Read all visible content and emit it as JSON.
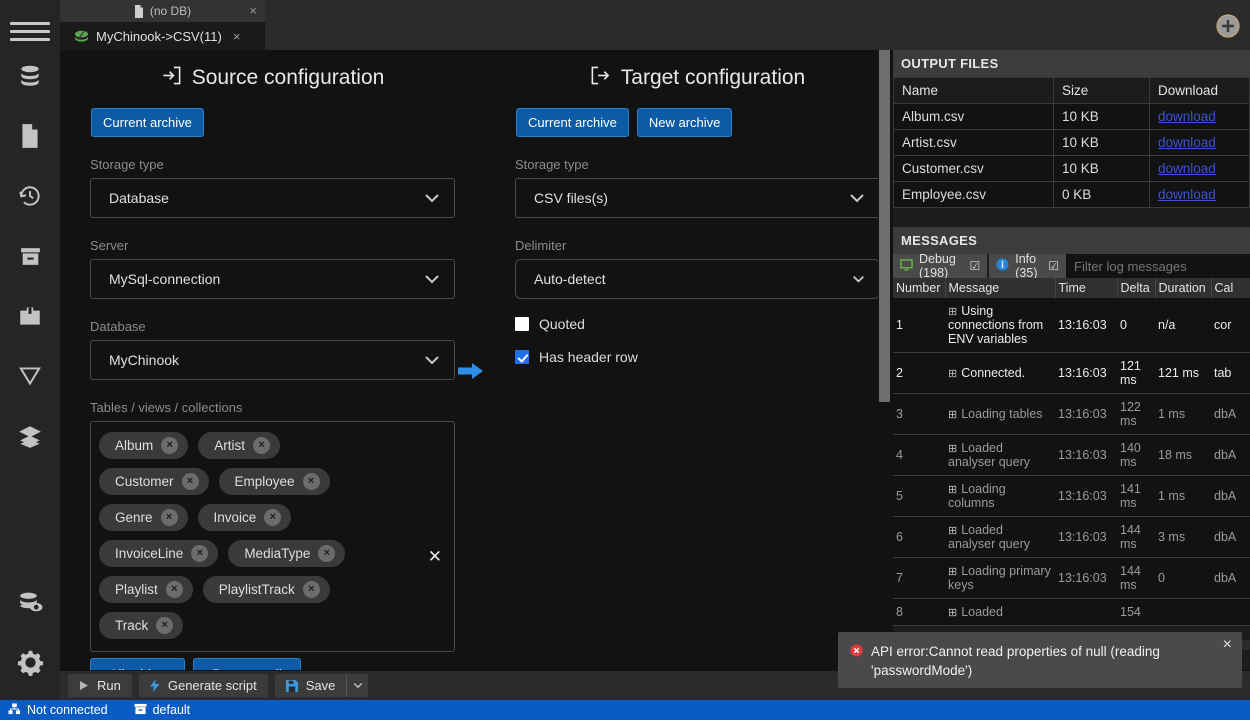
{
  "window": {
    "add_tab_icon": "plus-circle-icon"
  },
  "rail": {
    "menu_icon": "hamburger-menu-icon",
    "items": [
      {
        "icon": "database-icon"
      },
      {
        "icon": "file-icon"
      },
      {
        "icon": "history-clock-icon"
      },
      {
        "icon": "archive-box-icon"
      },
      {
        "icon": "toolbox-icon"
      },
      {
        "icon": "filter-funnel-icon"
      },
      {
        "icon": "layers-icon"
      },
      {
        "icon": "database-eye-icon"
      },
      {
        "icon": "gear-settings-icon"
      }
    ]
  },
  "tabs": {
    "inactive": {
      "label": "(no DB)",
      "icon": "document-icon",
      "close": "×"
    },
    "active": {
      "label": "MyChinook->CSV(11)",
      "icon": "leaf-icon",
      "close": "×"
    }
  },
  "source": {
    "title": "Source configuration",
    "title_icon": "import-arrow-icon",
    "buttons": [
      {
        "label": "Current archive"
      }
    ],
    "fields": [
      {
        "label": "Storage type",
        "value": "Database"
      },
      {
        "label": "Server",
        "value": "MySql-connection"
      },
      {
        "label": "Database",
        "value": "MyChinook"
      }
    ],
    "tables_label": "Tables / views / collections",
    "tags": [
      "Album",
      "Artist",
      "Customer",
      "Employee",
      "Genre",
      "Invoice",
      "InvoiceLine",
      "MediaType",
      "Playlist",
      "PlaylistTrack",
      "Track"
    ],
    "tag_remove_glyph": "×",
    "clear_all_glyph": "✕",
    "table_buttons": [
      {
        "label": "All tables"
      },
      {
        "label": "Remove all"
      }
    ]
  },
  "target": {
    "title": "Target configuration",
    "title_icon": "export-arrow-icon",
    "buttons": [
      {
        "label": "Current archive"
      },
      {
        "label": "New archive"
      }
    ],
    "fields": [
      {
        "label": "Storage type",
        "value": "CSV files(s)"
      },
      {
        "label": "Delimiter",
        "value": "Auto-detect"
      }
    ],
    "checkboxes": [
      {
        "label": "Quoted",
        "checked": false
      },
      {
        "label": "Has header row",
        "checked": true
      }
    ]
  },
  "arrow_icon": "right-arrow-icon",
  "output_files": {
    "title": "OUTPUT FILES",
    "columns": [
      "Name",
      "Size",
      "Download"
    ],
    "rows": [
      {
        "name": "Album.csv",
        "size": "10 KB",
        "download": "download"
      },
      {
        "name": "Artist.csv",
        "size": "10 KB",
        "download": "download"
      },
      {
        "name": "Customer.csv",
        "size": "10 KB",
        "download": "download"
      },
      {
        "name": "Employee.csv",
        "size": "0 KB",
        "download": "download"
      }
    ]
  },
  "messages": {
    "title": "MESSAGES",
    "tabs": [
      {
        "label": "Debug (198)",
        "icon": "monitor-icon",
        "checkbox": "☑"
      },
      {
        "label": "Info (35)",
        "icon": "info-circle-icon",
        "checkbox": "☑"
      }
    ],
    "filter_placeholder": "Filter log messages",
    "columns": [
      "Number",
      "Message",
      "Time",
      "Delta",
      "Duration",
      "Cal"
    ],
    "rows": [
      {
        "number": "1",
        "message": "Using connections from ENV variables",
        "time": "13:16:03",
        "delta": "0",
        "duration": "n/a",
        "cal": "cor",
        "bright": true
      },
      {
        "number": "2",
        "message": "Connected.",
        "time": "13:16:03",
        "delta": "121 ms",
        "duration": "121 ms",
        "cal": "tab",
        "bright": true
      },
      {
        "number": "3",
        "message": "Loading tables",
        "time": "13:16:03",
        "delta": "122 ms",
        "duration": "1 ms",
        "cal": "dbA",
        "bright": false
      },
      {
        "number": "4",
        "message": "Loaded analyser query",
        "time": "13:16:03",
        "delta": "140 ms",
        "duration": "18 ms",
        "cal": "dbA",
        "bright": false
      },
      {
        "number": "5",
        "message": "Loading columns",
        "time": "13:16:03",
        "delta": "141 ms",
        "duration": "1 ms",
        "cal": "dbA",
        "bright": false
      },
      {
        "number": "6",
        "message": "Loaded analyser query",
        "time": "13:16:03",
        "delta": "144 ms",
        "duration": "3 ms",
        "cal": "dbA",
        "bright": false
      },
      {
        "number": "7",
        "message": "Loading primary keys",
        "time": "13:16:03",
        "delta": "144 ms",
        "duration": "0",
        "cal": "dbA",
        "bright": false
      },
      {
        "number": "8",
        "message": "Loaded",
        "time": "",
        "delta": "154",
        "duration": "",
        "cal": "",
        "bright": false
      }
    ],
    "expand_glyph": "⊞"
  },
  "toolbar": {
    "run_label": "Run",
    "run_icon": "play-icon",
    "generate_label": "Generate script",
    "generate_icon": "lightning-bolt-icon",
    "save_label": "Save",
    "save_icon": "floppy-disk-icon",
    "save_caret_icon": "chevron-down-icon"
  },
  "status_bar": {
    "connection": "Not connected",
    "connection_icon": "network-disconnected-icon",
    "database": "default",
    "database_icon": "archive-icon"
  },
  "toast": {
    "icon": "error-circle-icon",
    "message": "API error:Cannot read properties of null (reading 'passwordMode')",
    "close": "×"
  },
  "colors": {
    "accent_blue": "#0d5aa7",
    "status_blue": "#0a5bc4",
    "link_blue": "#3b54d6",
    "arrow_blue": "#2f8ce8",
    "error_red": "#e03b3b",
    "leaf_green": "#5aa84f"
  }
}
